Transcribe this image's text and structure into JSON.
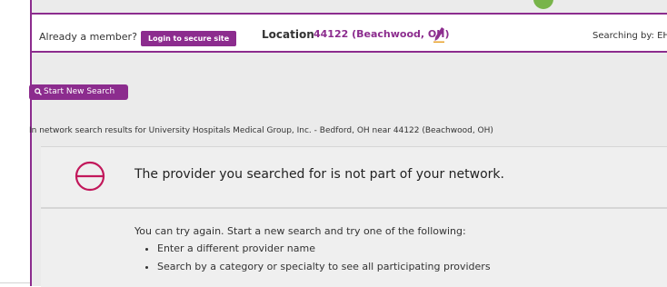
{
  "header": {
    "member_prompt": "Already a member?",
    "login_label": "Login to secure site",
    "location_label": "Location",
    "location_value": "44122 (Beachwood, OH)",
    "searching_by": "Searching by: EHP"
  },
  "search": {
    "start_new_label": "Start New Search",
    "results_line": "In network search results for University Hospitals Medical Group, Inc. - Bedford, OH near 44122 (Beachwood, OH)"
  },
  "alert": {
    "message": "The provider you searched for is not part of your network."
  },
  "suggestions": {
    "intro": "You can try again. Start a new search and try one of the following:",
    "items": [
      "Enter a different provider name",
      "Search by a category or specialty to see all participating providers"
    ]
  },
  "colors": {
    "brand_purple": "#8c2c8e",
    "panel_gray": "#ebebeb",
    "accent_green": "#78b44a"
  },
  "icons": [
    "pencil-icon",
    "search-icon",
    "no-entry-icon"
  ]
}
